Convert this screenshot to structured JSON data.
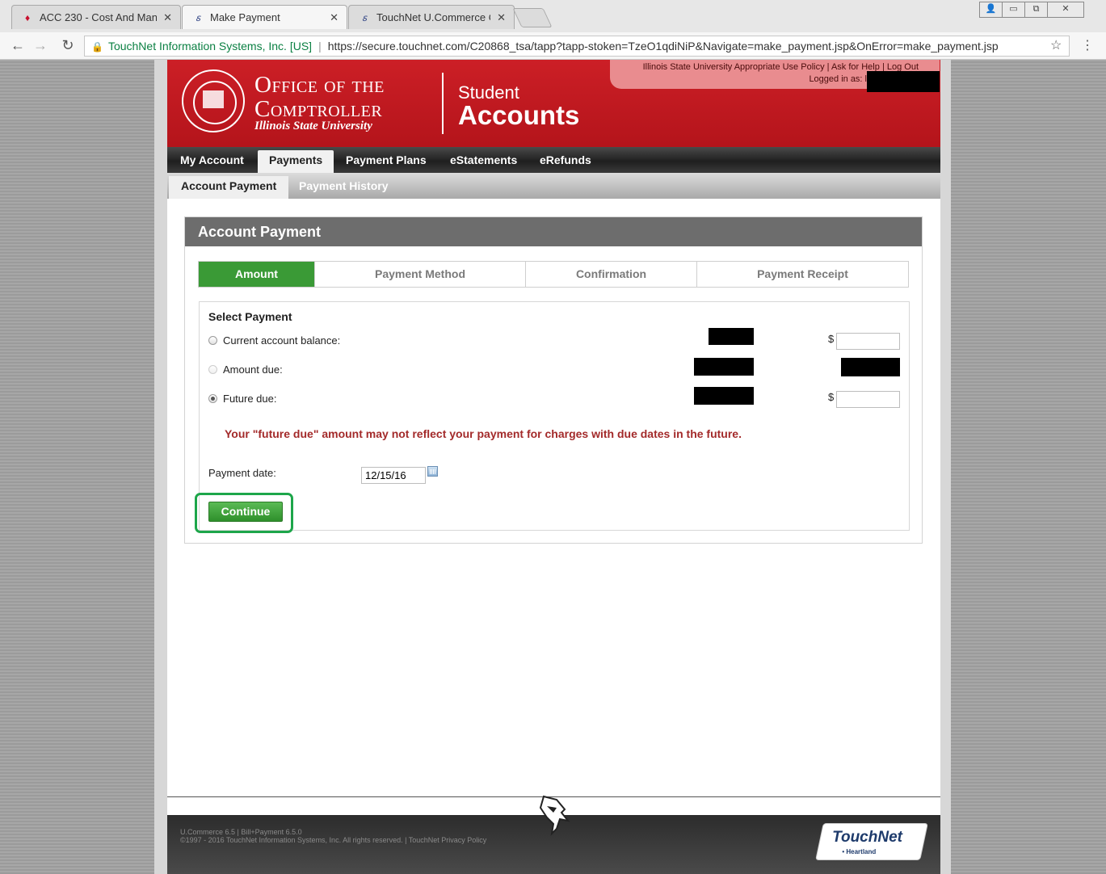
{
  "browser": {
    "tabs": [
      {
        "title": "ACC 230 - Cost And Man"
      },
      {
        "title": "Make Payment"
      },
      {
        "title": "TouchNet U.Commerce C"
      }
    ],
    "secure_label": "TouchNet Information Systems, Inc. [US]",
    "url": "https://secure.touchnet.com/C20868_tsa/tapp?tapp-stoken=TzeO1qdiNiP&Navigate=make_payment.jsp&OnError=make_payment.jsp"
  },
  "header": {
    "office_line1": "Office of the",
    "office_line2": "Comptroller",
    "university": "Illinois State University",
    "student": "Student",
    "accounts": "Accounts",
    "policy_link": "Illinois State University Appropriate Use Policy",
    "help_link": "Ask for Help",
    "logout_link": "Log Out",
    "logged_in": "Logged in as: l"
  },
  "nav": {
    "primary": [
      "My Account",
      "Payments",
      "Payment Plans",
      "eStatements",
      "eRefunds"
    ],
    "secondary": [
      "Account Payment",
      "Payment History"
    ]
  },
  "panel": {
    "title": "Account Payment",
    "steps": [
      "Amount",
      "Payment Method",
      "Confirmation",
      "Payment Receipt"
    ],
    "active_step": "Amount",
    "select_title": "Select Payment",
    "options": [
      {
        "label": "Current account balance:",
        "state": "unchecked",
        "currency": "$"
      },
      {
        "label": "Amount due:",
        "state": "disabled",
        "currency": ""
      },
      {
        "label": "Future due:",
        "state": "checked",
        "currency": "$"
      }
    ],
    "warning": "Your \"future due\" amount may not reflect your payment for charges with due dates in the future.",
    "payment_date_label": "Payment date:",
    "payment_date_value": "12/15/16",
    "continue_label": "Continue"
  },
  "footer": {
    "line1": "U.Commerce 6.5 | Bill+Payment 6.5.0",
    "line2": "©1997 - 2016  TouchNet Information Systems, Inc. All rights reserved.  |  TouchNet Privacy Policy",
    "logo_text": "TouchNet",
    "logo_sub": "• Heartland"
  },
  "colors": {
    "brand_red": "#cc1f26",
    "active_green": "#3a9a36",
    "warning_red": "#a32a2a",
    "highlight_green": "#1da64a"
  }
}
